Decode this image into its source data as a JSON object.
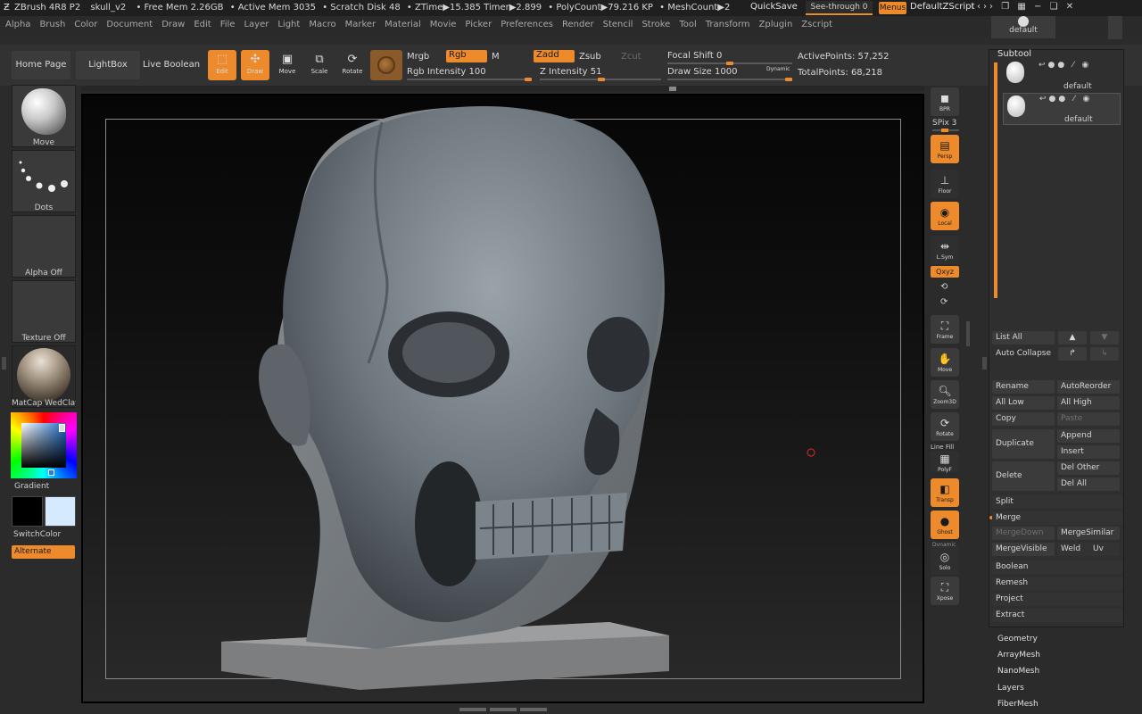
{
  "titlebar": {
    "app": "ZBrush 4R8 P2",
    "doc": "skull_v2",
    "free_mem": "• Free Mem 2.26GB",
    "active_mem": "• Active Mem 3035",
    "scratch": "• Scratch Disk 48",
    "ztime": "• ZTime▶15.385 Timer▶2.899",
    "polycount": "• PolyCount▶79.216 KP",
    "meshcount": "• MeshCount▶2",
    "quicksave": "QuickSave",
    "seethrough": "See-through  0",
    "menus": "Menus",
    "script": "DefaultZScript"
  },
  "menubar": [
    "Alpha",
    "Brush",
    "Color",
    "Document",
    "Draw",
    "Edit",
    "File",
    "Layer",
    "Light",
    "Macro",
    "Marker",
    "Material",
    "Movie",
    "Picker",
    "Preferences",
    "Render",
    "Stencil",
    "Stroke",
    "Tool",
    "Transform",
    "Zplugin",
    "Zscript"
  ],
  "topbar": {
    "home": "Home Page",
    "lightbox": "LightBox",
    "live_boolean": "Live Boolean",
    "edit": "Edit",
    "draw": "Draw",
    "move": "Move",
    "scale": "Scale",
    "rotate": "Rotate",
    "mrgb": "Mrgb",
    "rgb": "Rgb",
    "m": "M",
    "zadd": "Zadd",
    "zsub": "Zsub",
    "zcut": "Zcut",
    "rgb_intensity": "Rgb Intensity 100",
    "z_intensity": "Z Intensity 51",
    "focal_shift": "Focal Shift 0",
    "draw_size": "Draw Size 1000",
    "dynamic": "Dynamic",
    "active_points": "ActivePoints: 57,252",
    "total_points": "TotalPoints: 68,218",
    "rgb_intensity_value": 100,
    "z_intensity_value": 51,
    "focal_shift_value": 0,
    "draw_size_value": 1000
  },
  "left": {
    "brush": "Move",
    "stroke": "Dots",
    "alpha": "Alpha Off",
    "texture": "Texture Off",
    "material": "MatCap WedClay",
    "gradient": "Gradient",
    "switchcolor": "SwitchColor",
    "alternate": "Alternate"
  },
  "right_shelf": {
    "bpr": "BPR",
    "spix": "SPix 3",
    "persp": "Persp",
    "floor": "Floor",
    "local": "Local",
    "lsym": "L.Sym",
    "xyz": "Qxyz",
    "frame": "Frame",
    "move": "Move",
    "zoom3d": "Zoom3D",
    "rotate": "Rotate",
    "linefill": "Line Fill",
    "polyf": "PolyF",
    "transp": "Transp",
    "ghost": "Ghost",
    "dynamic": "Dynamic",
    "solo": "Solo",
    "xpose": "Xpose"
  },
  "subtool": {
    "top_label": "default",
    "title": "Subtool",
    "items": [
      {
        "name": "default"
      },
      {
        "name": "default"
      }
    ],
    "list_all": "List All",
    "auto_collapse": "Auto Collapse",
    "rename": "Rename",
    "autoreorder": "AutoReorder",
    "all_low": "All Low",
    "all_high": "All High",
    "copy": "Copy",
    "paste": "Paste",
    "duplicate": "Duplicate",
    "append": "Append",
    "insert": "Insert",
    "delete": "Delete",
    "del_other": "Del Other",
    "del_all": "Del All",
    "split": "Split",
    "merge": "Merge",
    "mergedown": "MergeDown",
    "mergesimilar": "MergeSimilar",
    "mergevisible": "MergeVisible",
    "weld": "Weld",
    "uv": "Uv",
    "boolean": "Boolean",
    "remesh": "Remesh",
    "project": "Project",
    "extract": "Extract"
  },
  "sections": [
    "Geometry",
    "ArrayMesh",
    "NanoMesh",
    "Layers",
    "FiberMesh"
  ],
  "colors": {
    "accent": "#ec8a2c",
    "panel": "#323232",
    "bg": "#2b2b2b"
  }
}
